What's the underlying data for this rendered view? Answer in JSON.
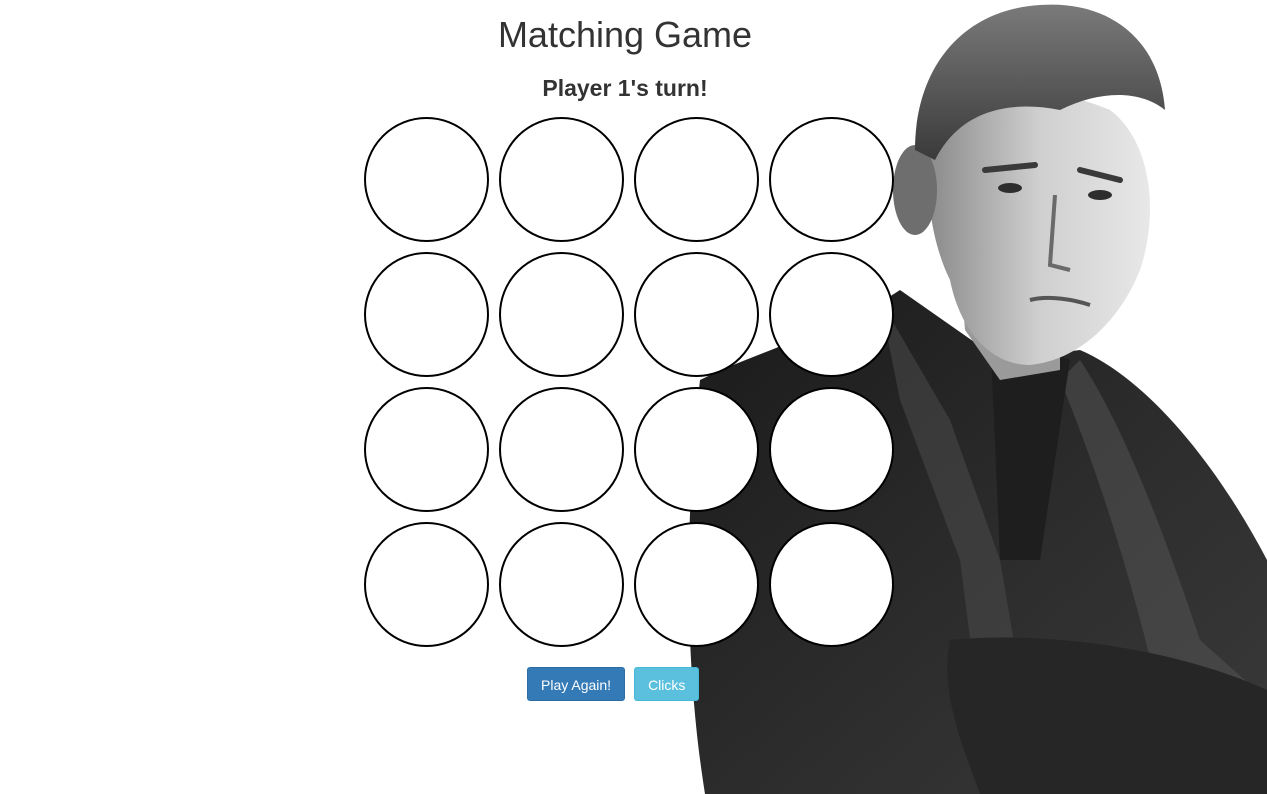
{
  "header": {
    "title": "Matching Game",
    "turn_text": "Player 1's turn!"
  },
  "board": {
    "rows": 4,
    "columns": 4,
    "cards": [
      {
        "state": "face-down"
      },
      {
        "state": "face-down"
      },
      {
        "state": "face-down"
      },
      {
        "state": "face-down"
      },
      {
        "state": "face-down"
      },
      {
        "state": "face-down"
      },
      {
        "state": "face-down"
      },
      {
        "state": "face-down"
      },
      {
        "state": "face-down"
      },
      {
        "state": "face-down"
      },
      {
        "state": "face-down"
      },
      {
        "state": "face-down"
      },
      {
        "state": "face-down"
      },
      {
        "state": "face-down"
      },
      {
        "state": "face-down"
      },
      {
        "state": "face-down"
      }
    ]
  },
  "controls": {
    "play_again_label": "Play Again!",
    "clicks_label": "Clicks"
  },
  "colors": {
    "primary_button": "#337ab7",
    "info_button": "#5bc0de",
    "card_border": "#000000",
    "card_fill": "#ffffff"
  }
}
